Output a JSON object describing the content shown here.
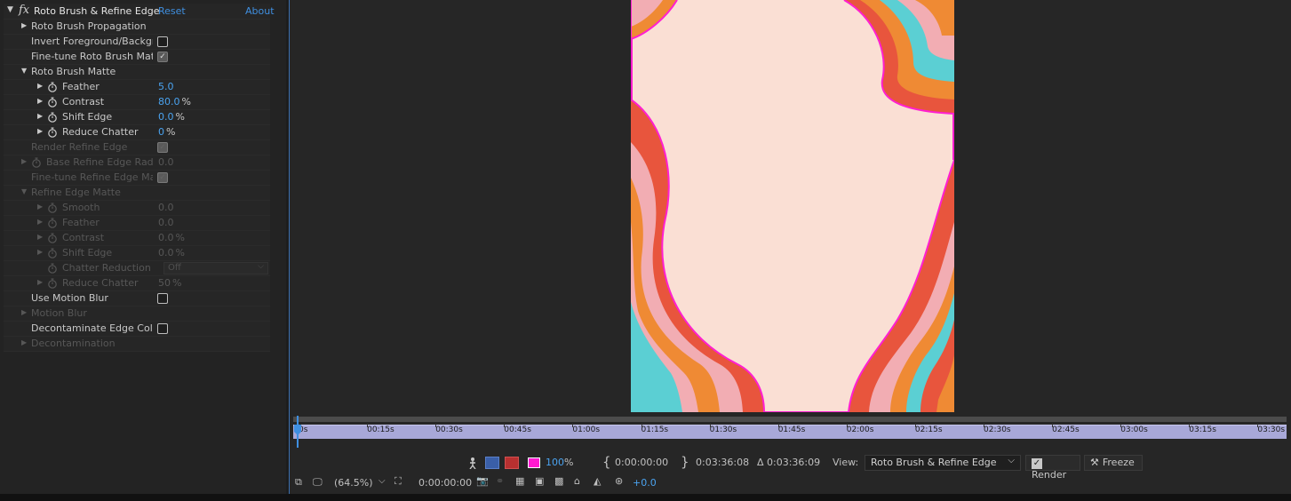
{
  "effect": {
    "name": "Roto Brush & Refine Edge",
    "reset": "Reset",
    "about": "About"
  },
  "props": [
    {
      "label": "Roto Brush Propagation",
      "twirl": "▶",
      "indent": 1,
      "dim": false
    },
    {
      "label": "Invert Foreground/Backgrou",
      "indent": 1,
      "check": false,
      "dim": false
    },
    {
      "label": "Fine-tune Roto Brush Matte",
      "indent": 1,
      "check": true,
      "dim": false
    },
    {
      "label": "Roto Brush Matte",
      "twirl": "▼",
      "indent": 1,
      "dim": false
    },
    {
      "label": "Feather",
      "twirl": "▶",
      "indent": 2,
      "stopwatch": true,
      "value": "5.0",
      "dim": false
    },
    {
      "label": "Contrast",
      "twirl": "▶",
      "indent": 2,
      "stopwatch": true,
      "value": "80.0",
      "unit": "%",
      "dim": false
    },
    {
      "label": "Shift Edge",
      "twirl": "▶",
      "indent": 2,
      "stopwatch": true,
      "value": "0.0",
      "unit": "%",
      "dim": false
    },
    {
      "label": "Reduce Chatter",
      "twirl": "▶",
      "indent": 2,
      "stopwatch": true,
      "value": "0",
      "unit": "%",
      "dim": false
    },
    {
      "label": "Render Refine Edge",
      "indent": 1,
      "check": true,
      "dim": true
    },
    {
      "label": "Base Refine Edge Radiu",
      "twirl": "▶",
      "indent": 1,
      "stopwatch": true,
      "value": "0.0",
      "dim": true
    },
    {
      "label": "Fine-tune Refine Edge Matt",
      "indent": 1,
      "check": true,
      "dim": true
    },
    {
      "label": "Refine Edge Matte",
      "twirl": "▼",
      "indent": 1,
      "dim": true
    },
    {
      "label": "Smooth",
      "twirl": "▶",
      "indent": 2,
      "stopwatch": true,
      "value": "0.0",
      "dim": true
    },
    {
      "label": "Feather",
      "twirl": "▶",
      "indent": 2,
      "stopwatch": true,
      "value": "0.0",
      "dim": true
    },
    {
      "label": "Contrast",
      "twirl": "▶",
      "indent": 2,
      "stopwatch": true,
      "value": "0.0",
      "unit": "%",
      "dim": true
    },
    {
      "label": "Shift Edge",
      "twirl": "▶",
      "indent": 2,
      "stopwatch": true,
      "value": "0.0",
      "unit": "%",
      "dim": true
    },
    {
      "label": "Chatter Reduction",
      "indent": 2,
      "stopwatch": true,
      "dropdown": "Off",
      "dim": true
    },
    {
      "label": "Reduce Chatter",
      "twirl": "▶",
      "indent": 2,
      "stopwatch": true,
      "value": "50",
      "unit": "%",
      "dim": true
    },
    {
      "label": "Use Motion Blur",
      "indent": 1,
      "check": false,
      "dim": false
    },
    {
      "label": "Motion Blur",
      "twirl": "▶",
      "indent": 1,
      "dim": true
    },
    {
      "label": "Decontaminate Edge Colors",
      "indent": 1,
      "check": false,
      "dim": false
    },
    {
      "label": "Decontamination",
      "twirl": "▶",
      "indent": 1,
      "dim": true
    }
  ],
  "ruler_ticks": [
    "0s",
    "00:15s",
    "00:30s",
    "00:45s",
    "01:00s",
    "01:15s",
    "01:30s",
    "01:45s",
    "02:00s",
    "02:15s",
    "02:30s",
    "02:45s",
    "03:00s",
    "03:15s",
    "03:30s"
  ],
  "roto_controls": {
    "opacity": "100",
    "opacity_unit": "%",
    "in_time": "0:00:00:00",
    "out_time": "0:03:36:08",
    "duration": "Δ 0:03:36:09",
    "view_label": "View:",
    "view_value": "Roto Brush & Refine Edge",
    "render_label": "Render",
    "freeze_label": "Freeze"
  },
  "viewer_controls": {
    "zoom": "(64.5%)",
    "timecode": "0:00:00:00",
    "exposure": "+0.0"
  },
  "colors": {
    "matte_outline": "#ff1fd0",
    "bg_pink": "#fadfd4",
    "red": "#e8553d",
    "orange": "#ef8a34",
    "pink": "#f2adb3",
    "teal": "#5bcfd3",
    "accent_blue": "#4aa3f0"
  }
}
